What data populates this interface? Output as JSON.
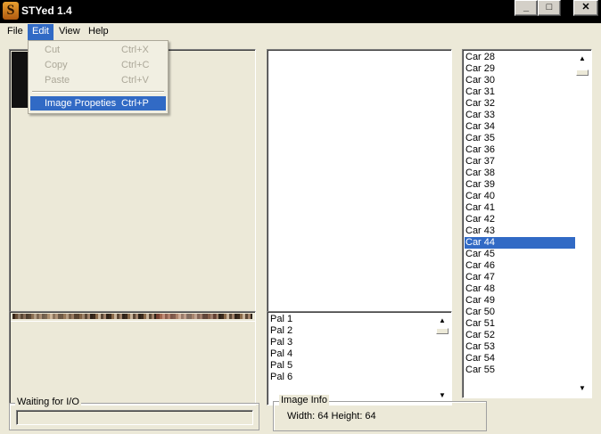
{
  "window": {
    "title": "STYed 1.4",
    "logo_letter": "S",
    "minimize": "_",
    "maximize": "□",
    "close": "✕"
  },
  "menu": {
    "file": "File",
    "edit": "Edit",
    "view": "View",
    "help": "Help"
  },
  "edit_menu": {
    "cut": {
      "label": "Cut",
      "shortcut": "Ctrl+X"
    },
    "copy": {
      "label": "Copy",
      "shortcut": "Ctrl+C"
    },
    "paste": {
      "label": "Paste",
      "shortcut": "Ctrl+V"
    },
    "image_properties": {
      "label": "Image Propeties",
      "shortcut": "Ctrl+P"
    }
  },
  "car_list": {
    "items": [
      "Car 28",
      "Car 29",
      "Car 30",
      "Car 31",
      "Car 32",
      "Car 33",
      "Car 34",
      "Car 35",
      "Car 36",
      "Car 37",
      "Car 38",
      "Car 39",
      "Car 40",
      "Car 41",
      "Car 42",
      "Car 43",
      "Car 44",
      "Car 45",
      "Car 46",
      "Car 47",
      "Car 48",
      "Car 49",
      "Car 50",
      "Car 51",
      "Car 52",
      "Car 53",
      "Car 54",
      "Car 55"
    ],
    "selected": "Car 44"
  },
  "pal_list": {
    "items": [
      "Pal 1",
      "Pal 2",
      "Pal 3",
      "Pal 4",
      "Pal 5",
      "Pal 6"
    ]
  },
  "status_group": {
    "label": "Waiting for I/O",
    "progress": 0
  },
  "image_info": {
    "label": "Image Info",
    "text": "Width: 64 Height: 64"
  },
  "scroll_arrows": {
    "up": "▲",
    "down": "▼"
  }
}
